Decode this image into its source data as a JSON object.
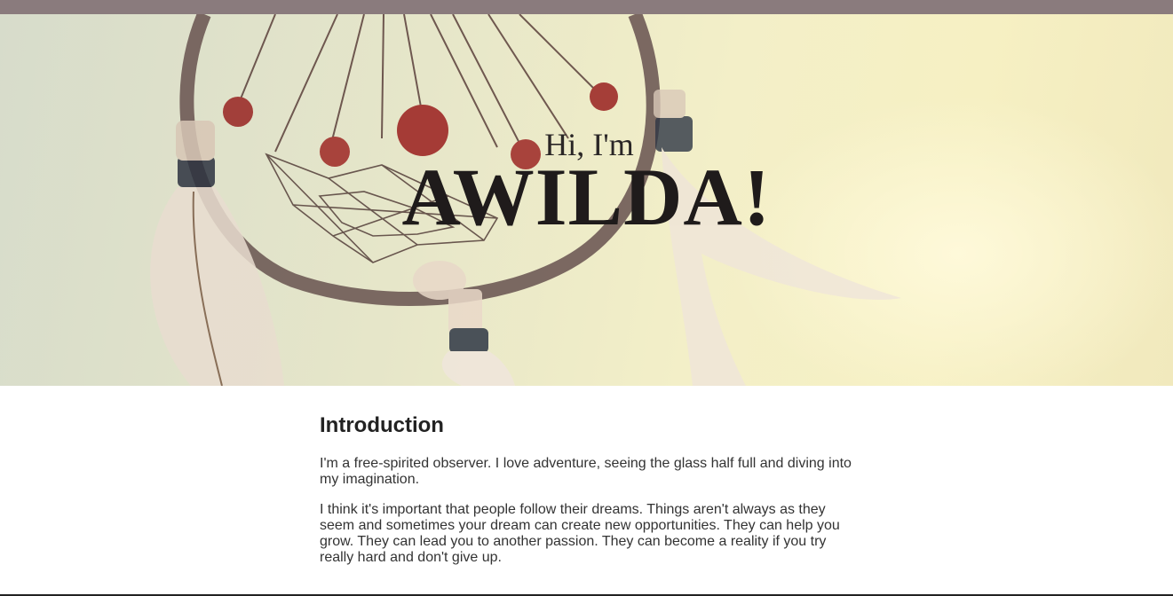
{
  "hero": {
    "greeting": "Hi, I'm",
    "name": "AWILDA!"
  },
  "intro": {
    "heading": "Introduction",
    "paragraphs": [
      "I'm a free-spirited observer. I love adventure, seeing the glass half full and diving into my imagination.",
      "I think it's important that people follow their dreams. Things aren't always as they seem and sometimes your dream can create new opportunities. They can help you grow. They can lead you to another passion. They can become a reality if you try really hard and don't give up."
    ]
  },
  "colors": {
    "topbar": "#8a7b7d",
    "text": "#222222"
  }
}
